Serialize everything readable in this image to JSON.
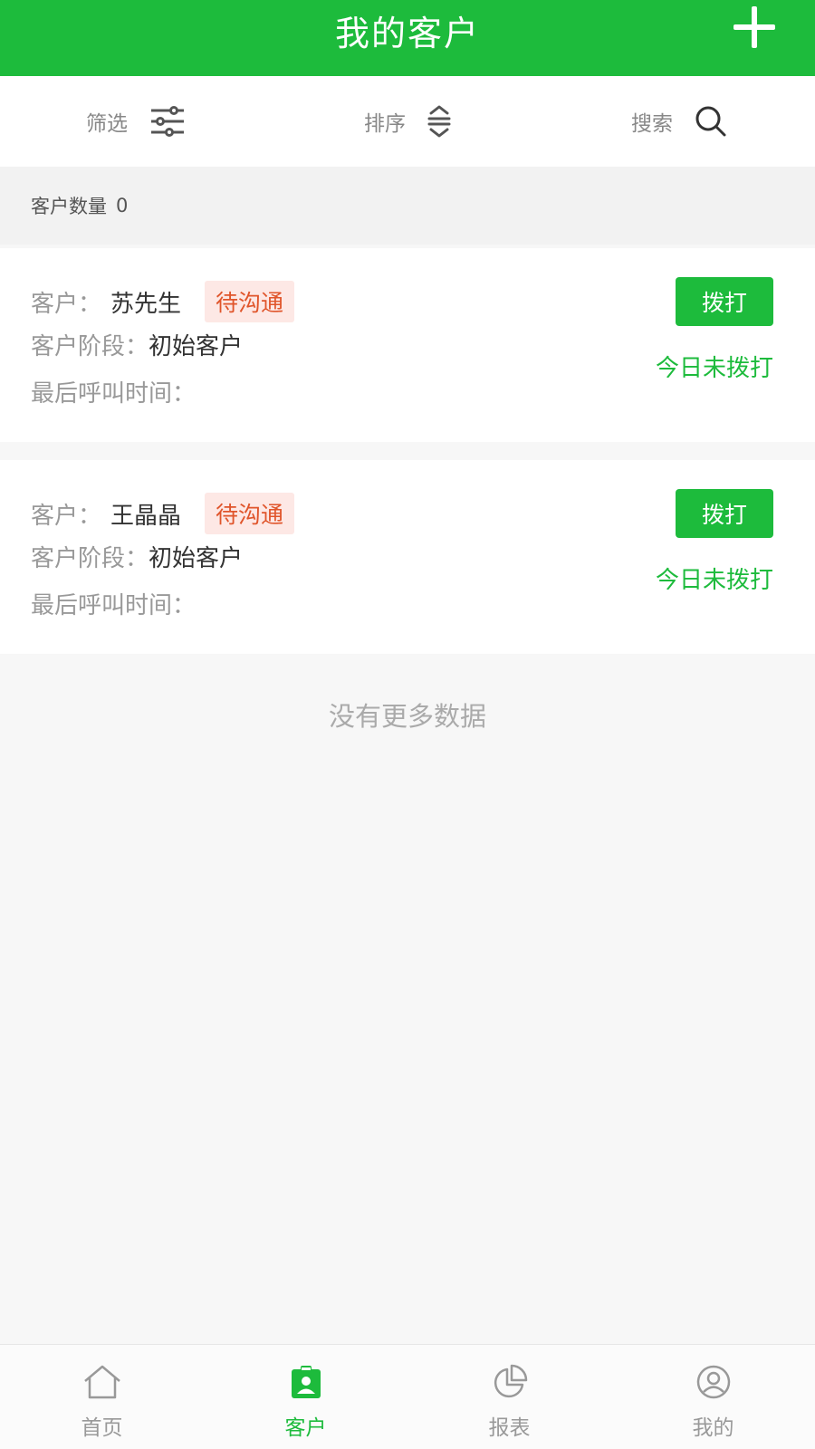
{
  "header": {
    "title": "我的客户",
    "add_icon": "plus-icon"
  },
  "toolbar": {
    "filter": {
      "label": "筛选",
      "icon": "filter-sliders-icon"
    },
    "sort": {
      "label": "排序",
      "icon": "sort-icon"
    },
    "search": {
      "label": "搜索",
      "icon": "search-icon"
    }
  },
  "summary": {
    "label": "客户数量",
    "count": "0"
  },
  "customers": [
    {
      "label_customer": "客户：",
      "name": "苏先生",
      "status": "待沟通",
      "label_stage": "客户阶段：",
      "stage": "初始客户",
      "label_last_call": "最后呼叫时间：",
      "last_call": "",
      "dial_label": "拨打",
      "call_status": "今日未拨打"
    },
    {
      "label_customer": "客户：",
      "name": "王晶晶",
      "status": "待沟通",
      "label_stage": "客户阶段：",
      "stage": "初始客户",
      "label_last_call": "最后呼叫时间：",
      "last_call": "",
      "dial_label": "拨打",
      "call_status": "今日未拨打"
    }
  ],
  "list_end_text": "没有更多数据",
  "nav": [
    {
      "label": "首页",
      "icon": "home-icon",
      "active": false
    },
    {
      "label": "客户",
      "icon": "contact-card-icon",
      "active": true
    },
    {
      "label": "报表",
      "icon": "pie-chart-icon",
      "active": false
    },
    {
      "label": "我的",
      "icon": "user-icon",
      "active": false
    }
  ],
  "colors": {
    "brand": "#1dbb3c",
    "badge_text": "#e0552b",
    "badge_bg": "#fde8e5"
  }
}
